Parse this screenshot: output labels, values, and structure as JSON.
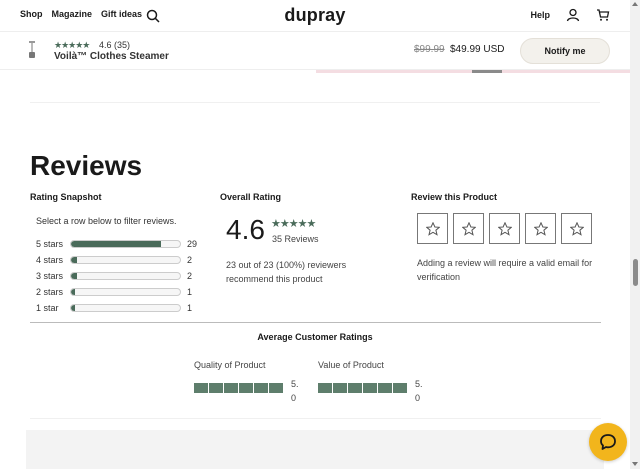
{
  "header": {
    "nav_left": [
      "Shop",
      "Magazine",
      "Gift ideas"
    ],
    "brand": "dupray",
    "help": "Help"
  },
  "product_bar": {
    "stars": "★★★★★",
    "rating_text": "4.6 (35)",
    "name": "Voilà™ Clothes Steamer",
    "price_old": "$99.99",
    "price_new": "$49.99 USD",
    "notify_label": "Notify me"
  },
  "reviews": {
    "title": "Reviews",
    "snapshot": {
      "title": "Rating Snapshot",
      "hint": "Select a row below to filter reviews.",
      "rows": [
        {
          "label": "5 stars",
          "count": "29",
          "fraction": 0.829
        },
        {
          "label": "4 stars",
          "count": "2",
          "fraction": 0.057
        },
        {
          "label": "3 stars",
          "count": "2",
          "fraction": 0.057
        },
        {
          "label": "2 stars",
          "count": "1",
          "fraction": 0.029
        },
        {
          "label": "1 star",
          "count": "1",
          "fraction": 0.029
        }
      ]
    },
    "overall": {
      "title": "Overall Rating",
      "rating": "4.6",
      "stars": "★★★★★",
      "count": "35 Reviews",
      "recommend": "23 out of 23 (100%) reviewers recommend this product"
    },
    "write": {
      "title": "Review this Product",
      "star_count": 5,
      "note": "Adding a review will require a valid email for verification"
    },
    "averages": {
      "title": "Average Customer Ratings",
      "metrics": [
        {
          "label": "Quality of Product",
          "value": "5.0",
          "fraction": 1.0
        },
        {
          "label": "Value of Product",
          "value": "5.0",
          "fraction": 1.0
        }
      ]
    }
  },
  "colors": {
    "accent": "#4a6b5a",
    "chat": "#f2b51c"
  }
}
